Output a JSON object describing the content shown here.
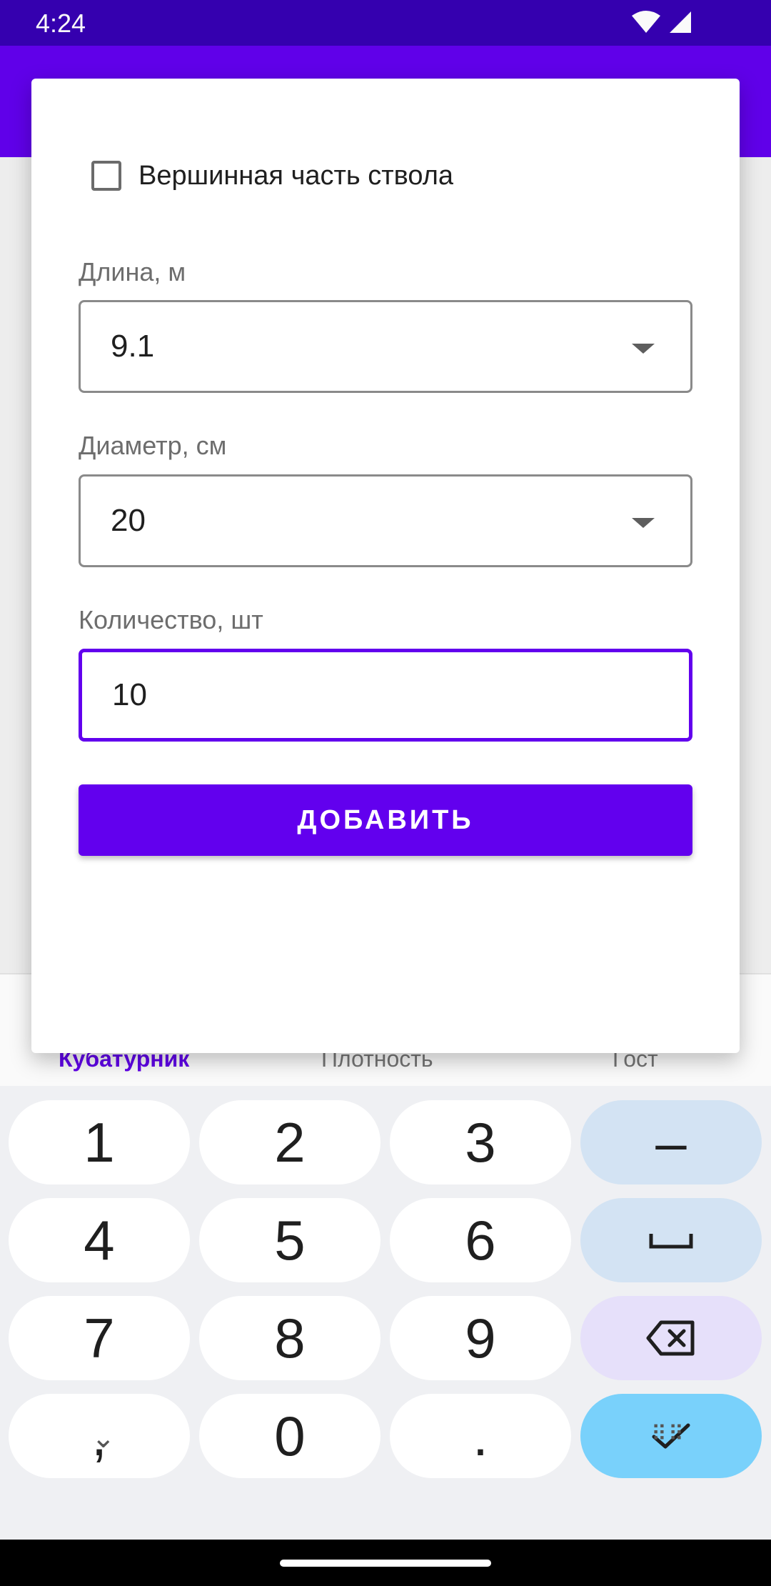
{
  "status_bar": {
    "time": "4:24",
    "wifi_icon": "wifi-icon",
    "signal_icon": "cell-signal-icon"
  },
  "bottom_tabs": [
    {
      "label": "Кубатурник",
      "active": true
    },
    {
      "label": "Плотность",
      "active": false
    },
    {
      "label": "Гост",
      "active": false
    }
  ],
  "dialog": {
    "checkbox": {
      "label": "Вершинная часть ствола",
      "checked": false
    },
    "length": {
      "label": "Длина, м",
      "value": "9.1"
    },
    "diameter": {
      "label": "Диаметр, см",
      "value": "20"
    },
    "quantity": {
      "label": "Количество, шт",
      "value": "10"
    },
    "add_button": "ДОБАВИТЬ"
  },
  "keyboard": {
    "rows": [
      [
        "1",
        "2",
        "3",
        "–"
      ],
      [
        "4",
        "5",
        "6",
        "space-icon"
      ],
      [
        "7",
        "8",
        "9",
        "backspace-icon"
      ],
      [
        ",",
        "0",
        ".",
        "check-icon"
      ]
    ],
    "bottom_left_icon": "collapse-keyboard-icon",
    "bottom_right_icon": "keyboard-switch-icon",
    "colors": {
      "side": "#d3e3f3",
      "delete": "#e6e0fa",
      "enter": "#79d1fb"
    }
  },
  "colors": {
    "primary": "#6200ee",
    "status_bar": "#3700b3"
  }
}
